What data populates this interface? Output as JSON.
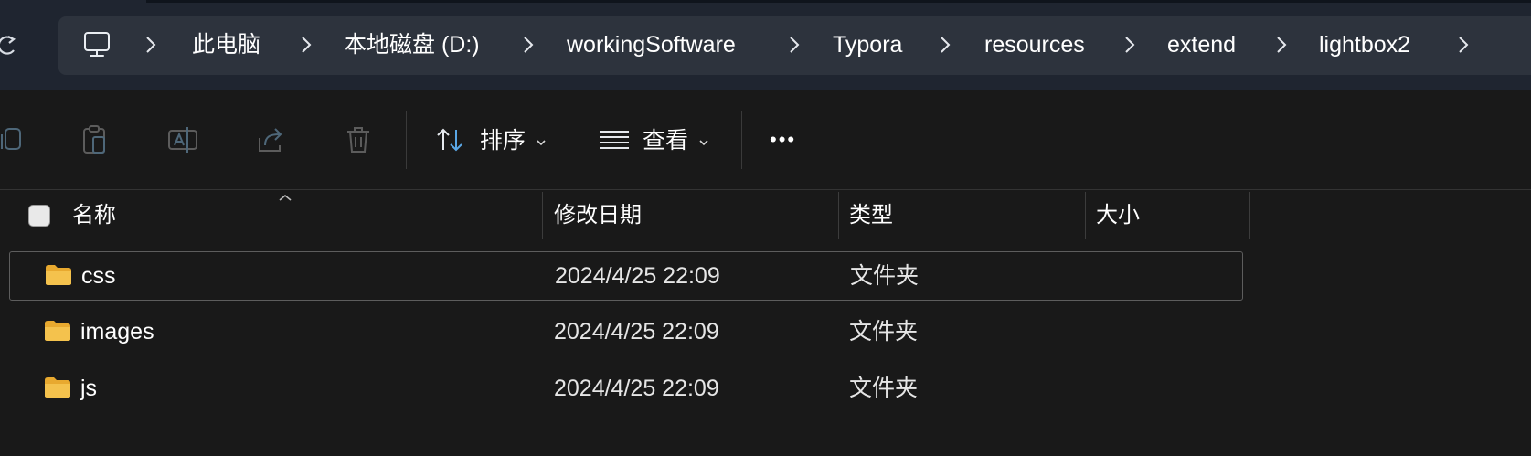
{
  "address_bar": {
    "breadcrumbs": [
      "此电脑",
      "本地磁盘 (D:)",
      "workingSoftware",
      "Typora",
      "resources",
      "extend",
      "lightbox2"
    ]
  },
  "toolbar": {
    "sort_label": "排序",
    "view_label": "查看",
    "more_label": "•••"
  },
  "columns": {
    "name": "名称",
    "modified": "修改日期",
    "type": "类型",
    "size": "大小"
  },
  "files": [
    {
      "name": "css",
      "modified": "2024/4/25 22:09",
      "type": "文件夹",
      "size": ""
    },
    {
      "name": "images",
      "modified": "2024/4/25 22:09",
      "type": "文件夹",
      "size": ""
    },
    {
      "name": "js",
      "modified": "2024/4/25 22:09",
      "type": "文件夹",
      "size": ""
    }
  ],
  "colors": {
    "folder": "#f4c24d",
    "accent_sort_arrow": "#5aa7e6",
    "background": "#191919",
    "address_bg": "#2d333d"
  }
}
